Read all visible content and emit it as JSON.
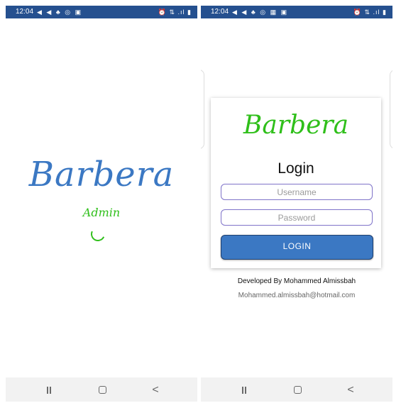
{
  "status_bar": {
    "left_time": "12:04",
    "right_time": "12:04",
    "left_notif": "◀ ◀ ♣ ◎ ▣",
    "right_notif": "◀ ◀ ♣ ◎ ▦ ▣",
    "system_icons": "⏰ ⇅ .ıl ▮"
  },
  "splash": {
    "logo": "Barbera",
    "subtitle": "Admin"
  },
  "login": {
    "logo": "Barbera",
    "title": "Login",
    "username_placeholder": "Username",
    "password_placeholder": "Password",
    "button_label": "LOGIN",
    "developer_credit": "Developed By Mohammed Almissbah",
    "developer_email": "Mohammed.almissbah@hotmail.com"
  },
  "nav_bar": {
    "icons": [
      "recents-icon",
      "home-icon",
      "back-icon"
    ],
    "back_glyph": "<"
  },
  "colors": {
    "status_bar": "#25508f",
    "brand_blue": "#3b78c3",
    "brand_green": "#2fbf1a",
    "field_border": "#7f73c9"
  }
}
